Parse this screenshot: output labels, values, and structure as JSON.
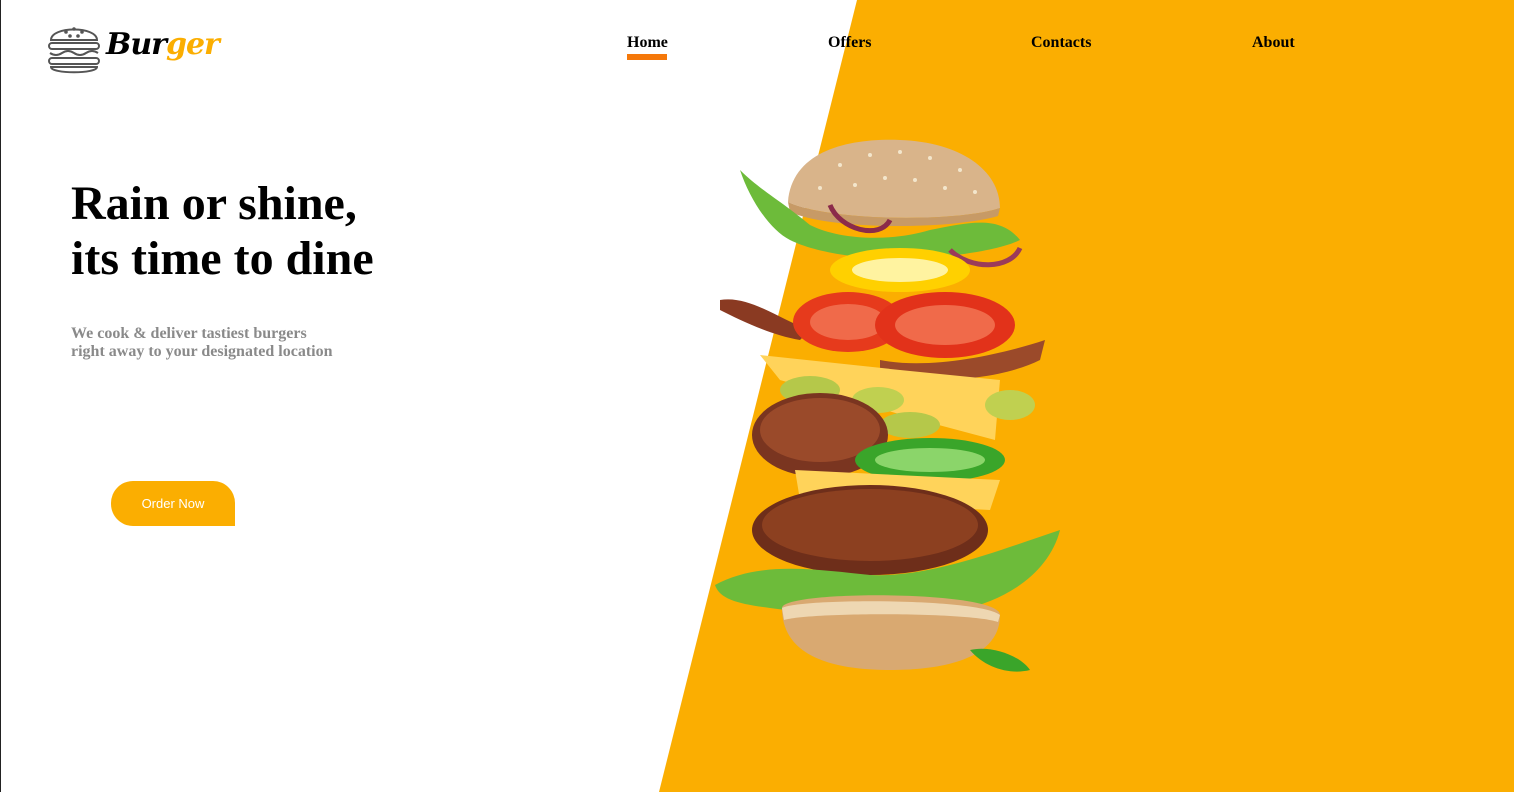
{
  "brand": {
    "name_part1": "Bur",
    "name_part2": "ger",
    "logo_icon": "burger-outline-icon"
  },
  "nav": {
    "items": [
      {
        "label": "Home",
        "active": true
      },
      {
        "label": "Offers",
        "active": false
      },
      {
        "label": "Contacts",
        "active": false
      },
      {
        "label": "About",
        "active": false
      }
    ]
  },
  "hero": {
    "title_line1": "Rain or shine,",
    "title_line2": "its time to dine",
    "subtitle_line1": "We cook & deliver tastiest burgers",
    "subtitle_line2": "right away to your designated location",
    "cta_label": "Order Now"
  },
  "colors": {
    "accent_yellow": "#fbae01",
    "nav_underline": "#f5780a",
    "subtitle_gray": "#8a8a8a"
  },
  "illustration": "flying-burger-image"
}
